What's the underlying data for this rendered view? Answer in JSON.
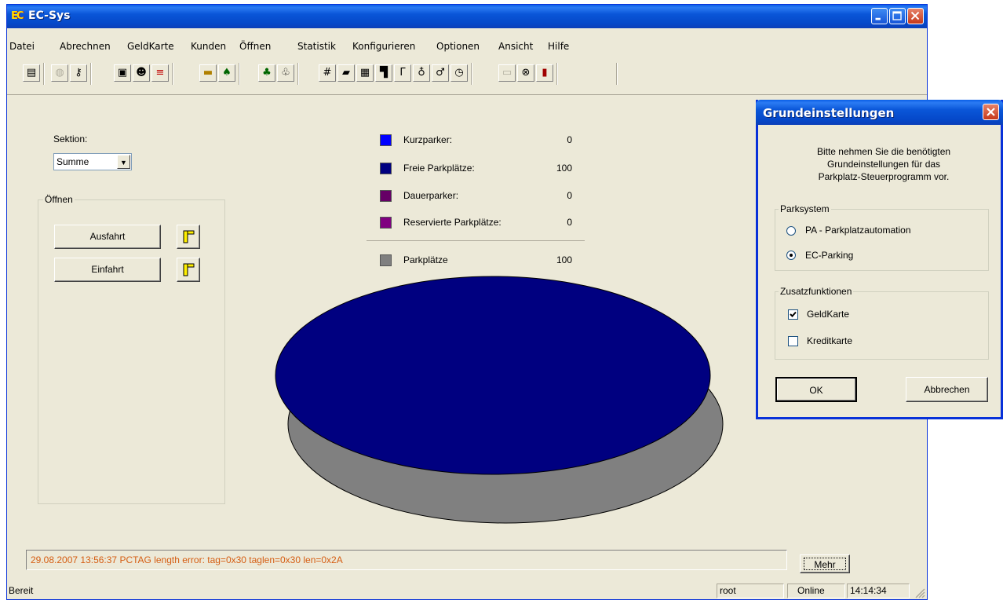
{
  "window": {
    "title": "EC-Sys",
    "icon": "ec-logo-icon"
  },
  "menu": [
    "Datei",
    "Abrechnen",
    "GeldKarte",
    "Kunden",
    "Öffnen",
    "Statistik",
    "Konfigurieren",
    "Optionen",
    "Ansicht",
    "Hilfe"
  ],
  "toolbar": {
    "icons": [
      "print-icon",
      "disabled-icon",
      "key-icon",
      "report-icon",
      "user-search-icon",
      "flag-icon",
      "card-icon",
      "car-icon",
      "stats-89-icon",
      "stats-89b-icon",
      "edit-icon",
      "folder-icon",
      "document-icon",
      "barrier-icon",
      "gate-icon",
      "person-89-icon",
      "person-icon",
      "clock-icon",
      "monitor-icon",
      "lock-icon",
      "exit-icon"
    ]
  },
  "sektion": {
    "label": "Sektion:",
    "value": "Summe"
  },
  "oeffnen": {
    "title": "Öffnen",
    "ausfahrt": "Ausfahrt",
    "einfahrt": "Einfahrt"
  },
  "legend": [
    {
      "label": "Kurzparker:",
      "value": "0",
      "color": "#0000ff"
    },
    {
      "label": "Freie Parkplätze:",
      "value": "100",
      "color": "#000080"
    },
    {
      "label": "Dauerparker:",
      "value": "0",
      "color": "#660066"
    },
    {
      "label": "Reservierte Parkplätze:",
      "value": "0",
      "color": "#800080"
    }
  ],
  "total": {
    "label": "Parkplätze",
    "value": "100",
    "color": "#808080"
  },
  "chart_data": {
    "type": "pie",
    "categories": [
      "Kurzparker",
      "Freie Parkplätze",
      "Dauerparker",
      "Reservierte Parkplätze"
    ],
    "values": [
      0,
      100,
      0,
      0
    ],
    "colors": [
      "#0000ff",
      "#000080",
      "#660066",
      "#800080"
    ],
    "title": ""
  },
  "log": {
    "message": "29.08.2007 13:56:37 PCTAG length error: tag=0x30 taglen=0x30 len=0x2A",
    "button": "Mehr"
  },
  "status": {
    "text": "Bereit",
    "user": "root",
    "connection": "Online",
    "time": "14:14:34"
  },
  "dialog": {
    "title": "Grundeinstellungen",
    "intro": [
      "Bitte nehmen Sie die benötigten",
      "Grundeinstellungen für das",
      "Parkplatz-Steuerprogramm vor."
    ],
    "parksystem": {
      "title": "Parksystem",
      "options": [
        "PA - Parkplatzautomation",
        "EC-Parking"
      ],
      "selected": "EC-Parking"
    },
    "zusatz": {
      "title": "Zusatzfunktionen",
      "geldkarte": "GeldKarte",
      "geldkarte_checked": true,
      "kreditkarte": "Kreditkarte",
      "kreditkarte_checked": false
    },
    "ok": "OK",
    "cancel": "Abbrechen"
  }
}
